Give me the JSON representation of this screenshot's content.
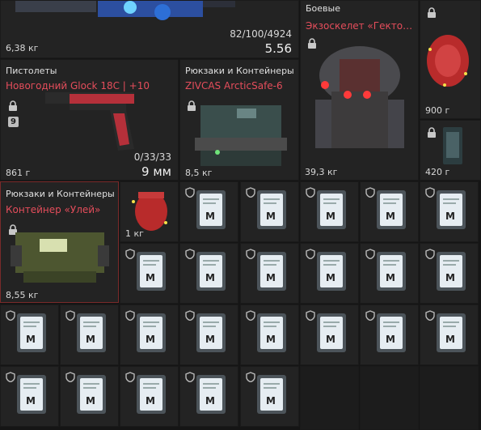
{
  "top_item": {
    "weight": "6,38 кг",
    "ammo": "82/100/4924",
    "caliber": "5.56"
  },
  "pistol": {
    "category": "Пистолеты",
    "name": "Новогодний Glock 18C | +10",
    "badge": "9",
    "weight": "861 г",
    "ammo": "0/33/33",
    "caliber": "9 мм"
  },
  "backpack1": {
    "category": "Рюкзаки и Контейнеры",
    "name": "ZIVCAS ArcticSafe-6",
    "weight": "8,5 кг"
  },
  "armor": {
    "category": "Боевые",
    "name": "Экзоскелет «Гектор» | ...",
    "weight": "39,3 кг"
  },
  "side_items": [
    {
      "weight": "900 г"
    },
    {
      "weight": "420 г"
    }
  ],
  "backpack2": {
    "category": "Рюкзаки и Контейнеры",
    "name": "Контейнер «Улей»",
    "weight": "8,55 кг"
  },
  "small_item": {
    "weight": "1 кг"
  },
  "ticket_count": 24,
  "colors": {
    "accent_red": "#e44d5b",
    "cell_bg": "#232323",
    "grid_bg": "#151515"
  }
}
